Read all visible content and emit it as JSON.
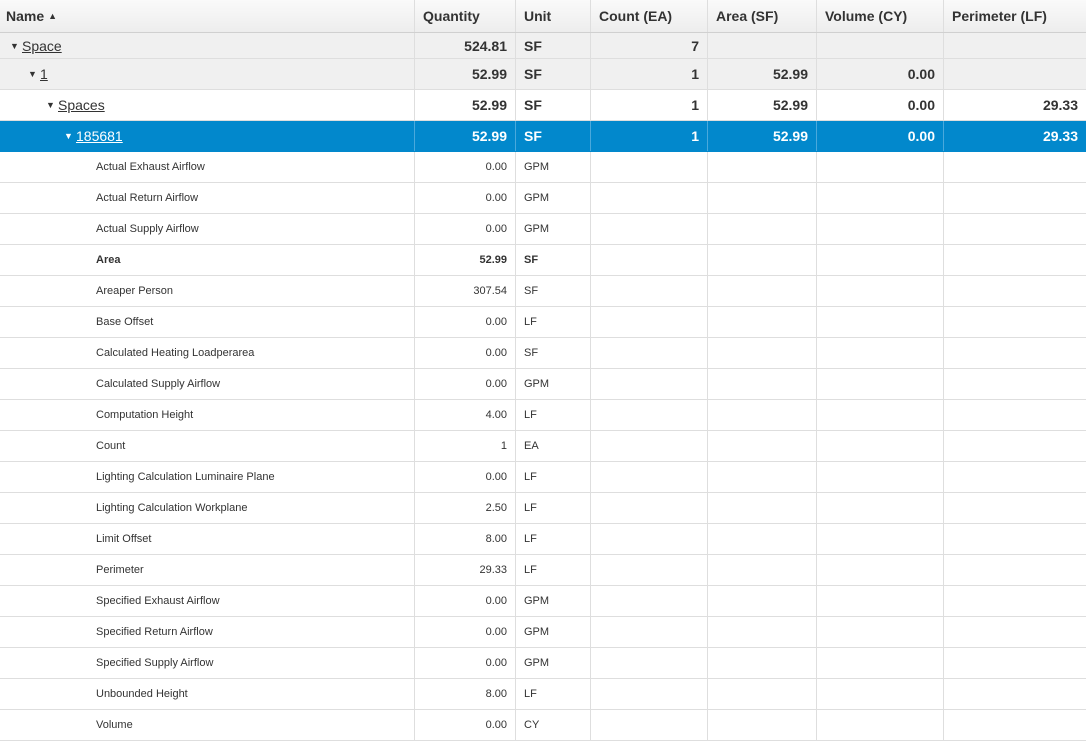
{
  "header": {
    "name": "Name",
    "sort_icon": "sort-ascending-icon",
    "quantity": "Quantity",
    "unit": "Unit",
    "count": "Count (EA)",
    "area": "Area (SF)",
    "volume": "Volume (CY)",
    "perimeter": "Perimeter (LF)"
  },
  "groups": [
    {
      "name": "Space",
      "quantity": "524.81",
      "unit": "SF",
      "count": "7",
      "area": "",
      "volume": "",
      "perimeter": ""
    },
    {
      "name": "1",
      "quantity": "52.99",
      "unit": "SF",
      "count": "1",
      "area": "52.99",
      "volume": "0.00",
      "perimeter": ""
    },
    {
      "name": "Spaces",
      "quantity": "52.99",
      "unit": "SF",
      "count": "1",
      "area": "52.99",
      "volume": "0.00",
      "perimeter": "29.33"
    },
    {
      "name": "185681",
      "quantity": "52.99",
      "unit": "SF",
      "count": "1",
      "area": "52.99",
      "volume": "0.00",
      "perimeter": "29.33"
    }
  ],
  "properties": [
    {
      "name": "Actual Exhaust Airflow",
      "quantity": "0.00",
      "unit": "GPM"
    },
    {
      "name": "Actual Return Airflow",
      "quantity": "0.00",
      "unit": "GPM"
    },
    {
      "name": "Actual Supply Airflow",
      "quantity": "0.00",
      "unit": "GPM"
    },
    {
      "name": "Area",
      "quantity": "52.99",
      "unit": "SF"
    },
    {
      "name": "Areaper Person",
      "quantity": "307.54",
      "unit": "SF"
    },
    {
      "name": "Base Offset",
      "quantity": "0.00",
      "unit": "LF"
    },
    {
      "name": "Calculated Heating Loadperarea",
      "quantity": "0.00",
      "unit": "SF"
    },
    {
      "name": "Calculated Supply Airflow",
      "quantity": "0.00",
      "unit": "GPM"
    },
    {
      "name": "Computation Height",
      "quantity": "4.00",
      "unit": "LF"
    },
    {
      "name": "Count",
      "quantity": "1",
      "unit": "EA"
    },
    {
      "name": "Lighting Calculation Luminaire Plane",
      "quantity": "0.00",
      "unit": "LF"
    },
    {
      "name": "Lighting Calculation Workplane",
      "quantity": "2.50",
      "unit": "LF"
    },
    {
      "name": "Limit Offset",
      "quantity": "8.00",
      "unit": "LF"
    },
    {
      "name": "Perimeter",
      "quantity": "29.33",
      "unit": "LF"
    },
    {
      "name": "Specified Exhaust Airflow",
      "quantity": "0.00",
      "unit": "GPM"
    },
    {
      "name": "Specified Return Airflow",
      "quantity": "0.00",
      "unit": "GPM"
    },
    {
      "name": "Specified Supply Airflow",
      "quantity": "0.00",
      "unit": "GPM"
    },
    {
      "name": "Unbounded Height",
      "quantity": "8.00",
      "unit": "LF"
    },
    {
      "name": "Volume",
      "quantity": "0.00",
      "unit": "CY"
    }
  ],
  "colors": {
    "selected_row": "#0288cc",
    "border": "#dedede",
    "group_background": "#f0f0f0"
  },
  "icons": {
    "expander": "caret-down-icon"
  }
}
